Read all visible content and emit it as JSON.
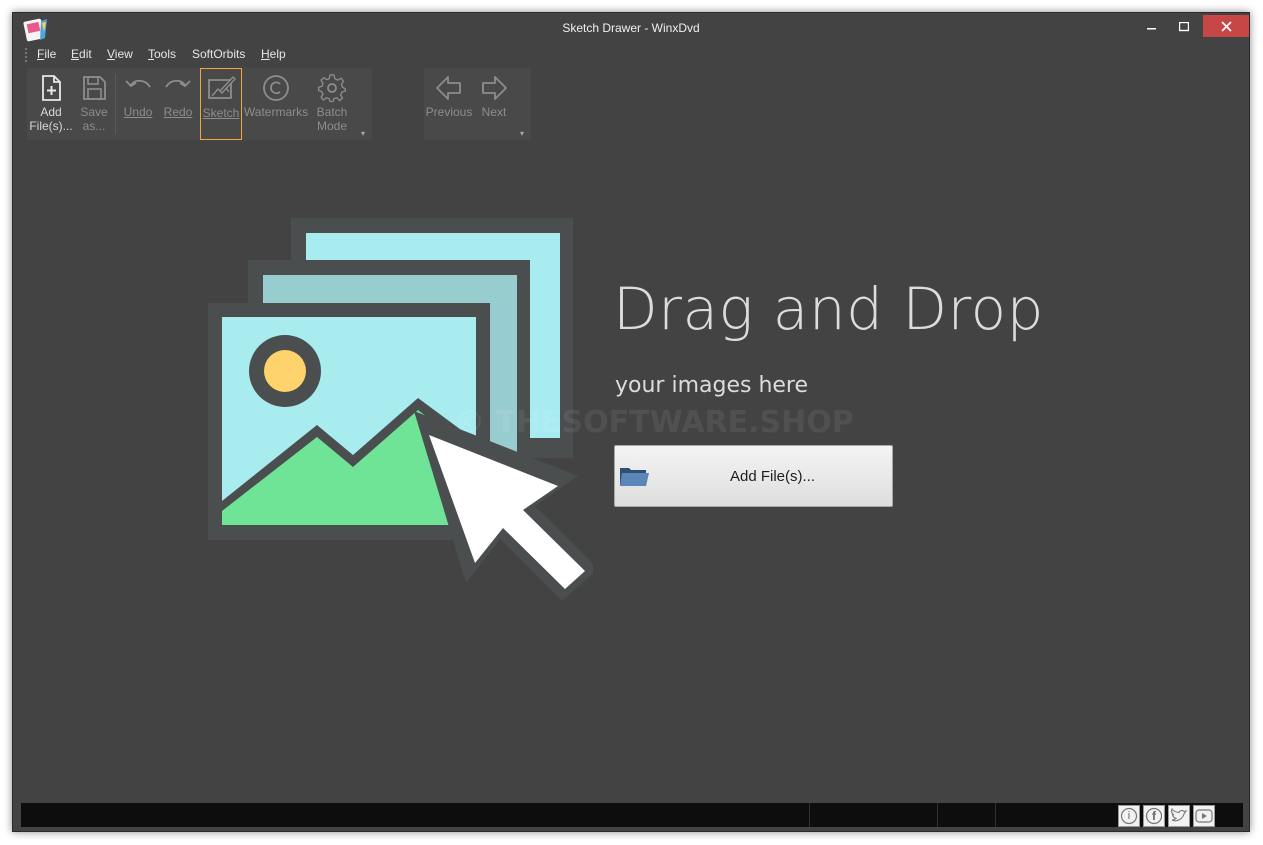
{
  "window": {
    "title": "Sketch Drawer - WinxDvd",
    "minimize_glyph": "–",
    "maximize_glyph": "☐",
    "close_glyph": "✕"
  },
  "menu": [
    {
      "u": "F",
      "rest": "ile"
    },
    {
      "u": "E",
      "rest": "dit"
    },
    {
      "u": "V",
      "rest": "iew"
    },
    {
      "u": "T",
      "rest": "ools"
    },
    {
      "u": "",
      "rest": "SoftOrbits"
    },
    {
      "u": "H",
      "rest": "elp"
    }
  ],
  "toolbar": {
    "add_files": {
      "line1": "Add",
      "line2": "File(s)...",
      "icon": "file-add-icon"
    },
    "save_as": {
      "line1": "Save",
      "line2": "as...",
      "icon": "save-icon"
    },
    "undo": {
      "label": "Undo",
      "icon": "undo-icon"
    },
    "redo": {
      "label": "Redo",
      "icon": "redo-icon"
    },
    "sketch": {
      "label": "Sketch",
      "icon": "sketch-icon"
    },
    "watermarks": {
      "label": "Watermarks",
      "icon": "copyright-icon"
    },
    "batch_mode": {
      "line1": "Batch",
      "line2": "Mode",
      "icon": "gear-icon"
    },
    "previous": {
      "label": "Previous",
      "icon": "arrow-left-icon"
    },
    "next": {
      "label": "Next",
      "icon": "arrow-right-icon"
    }
  },
  "main": {
    "title": "Drag and Drop",
    "subtitle": "your images here",
    "watermark": "© THESOFTWARE.SHOP",
    "add_button": "Add File(s)..."
  },
  "status": {
    "icons": [
      "info-icon",
      "facebook-icon",
      "twitter-icon",
      "youtube-icon"
    ],
    "info_glyph": "i",
    "facebook_glyph": "f"
  },
  "colors": {
    "background": "#434343",
    "photo_light": "#a8ecf0",
    "photo_mid": "#98cdd0",
    "mountain": "#6fe496",
    "sun": "#ffd36b",
    "accent_selected": "#f0a640",
    "close_button": "#c74646"
  }
}
